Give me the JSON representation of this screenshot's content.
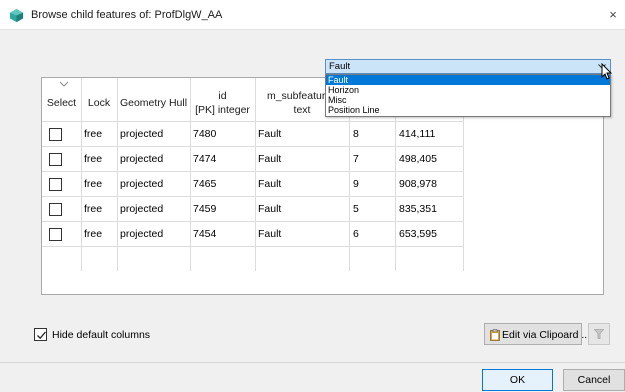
{
  "window": {
    "title": "Browse child features of: ProfDlgW_AA",
    "close_glyph": "×",
    "icon": "app-icon"
  },
  "filter_combo": {
    "value": "Fault",
    "options": [
      "Fault",
      "Horizon",
      "Misc",
      "Position Line"
    ],
    "selected_index": 0
  },
  "table": {
    "headers": {
      "select": "Select",
      "lock": "Lock",
      "geometry_hull": "Geometry Hull",
      "id_line1": "id",
      "id_line2": "[PK] integer",
      "subfeature_line1": "m_subfeature_",
      "subfeature_line2": "text"
    },
    "rows": [
      {
        "checked": false,
        "lock": "free",
        "hull": "projected",
        "id": "7480",
        "subfeature": "Fault",
        "count": "8",
        "value": "414,111"
      },
      {
        "checked": false,
        "lock": "free",
        "hull": "projected",
        "id": "7474",
        "subfeature": "Fault",
        "count": "7",
        "value": "498,405"
      },
      {
        "checked": false,
        "lock": "free",
        "hull": "projected",
        "id": "7465",
        "subfeature": "Fault",
        "count": "9",
        "value": "908,978"
      },
      {
        "checked": false,
        "lock": "free",
        "hull": "projected",
        "id": "7459",
        "subfeature": "Fault",
        "count": "5",
        "value": "835,351"
      },
      {
        "checked": false,
        "lock": "free",
        "hull": "projected",
        "id": "7454",
        "subfeature": "Fault",
        "count": "6",
        "value": "653,595"
      }
    ]
  },
  "footer": {
    "hide_default_columns_label": "Hide default columns",
    "hide_default_columns_checked": true,
    "edit_clipboard_label": "Edit via Clipoard ...",
    "ok_label": "OK",
    "cancel_label": "Cancel"
  },
  "colors": {
    "selection": "#0078d7",
    "combo_highlight": "#cce4f7",
    "app_icon": "#2fa6a0"
  }
}
